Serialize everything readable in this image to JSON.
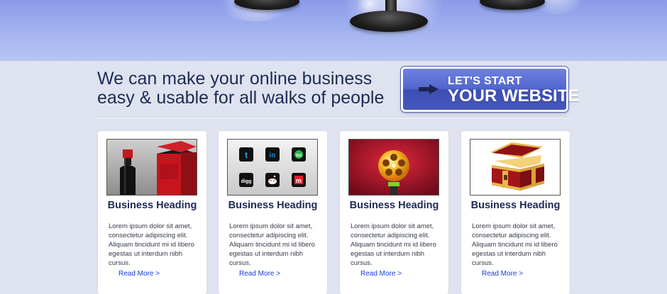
{
  "tagline": {
    "line1": "We can make your online business",
    "line2": "easy & usable for all walks of people"
  },
  "cta": {
    "line1": "LET'S START",
    "line2": "YOUR WEBSITE",
    "icon": "arrow-right-icon"
  },
  "cards": [
    {
      "image": "wine-bottle-and-box",
      "heading": "Business Heading",
      "body": "Lorem ipsum dolor sit amet, consectetur adipiscing elit. Aliquam tincidunt mi id libero egestas ut interdum nibh cursus.",
      "link": "Read More >"
    },
    {
      "image": "social-icons",
      "heading": "Business Heading",
      "body": "Lorem ipsum dolor sit amet, consectetur adipiscing elit. Aliquam tincidunt mi id libero egestas ut interdum nibh cursus.",
      "link": "Read More >",
      "social_icons": [
        {
          "label": "t",
          "color": "#29a9e1",
          "name": "twitter-icon"
        },
        {
          "label": "in",
          "color": "#1e86c6",
          "name": "linkedin-icon"
        },
        {
          "label": "su",
          "color": "#2bb24c",
          "name": "stumbleupon-icon"
        },
        {
          "label": "digg",
          "color": "#ffffff",
          "name": "digg-icon"
        },
        {
          "label": "☺",
          "color": "#ff5700",
          "name": "reddit-icon"
        },
        {
          "label": "m",
          "color": "#e8202a",
          "name": "mixx-icon"
        }
      ]
    },
    {
      "image": "film-reel-robot",
      "heading": "Business Heading",
      "body": "Lorem ipsum dolor sit amet, consectetur adipiscing elit. Aliquam tincidunt mi id libero egestas ut interdum nibh cursus.",
      "link": "Read More >"
    },
    {
      "image": "treasure-chest",
      "heading": "Business Heading",
      "body": "Lorem ipsum dolor sit amet, consectetur adipiscing elit. Aliquam tincidunt mi id libero egestas ut interdum nibh cursus.",
      "link": "Read More >"
    }
  ],
  "colors": {
    "heading": "#1d2b55",
    "link": "#1b3bd6",
    "page_bg": "#dfe3ef",
    "cta_bg": "#5266cc"
  }
}
